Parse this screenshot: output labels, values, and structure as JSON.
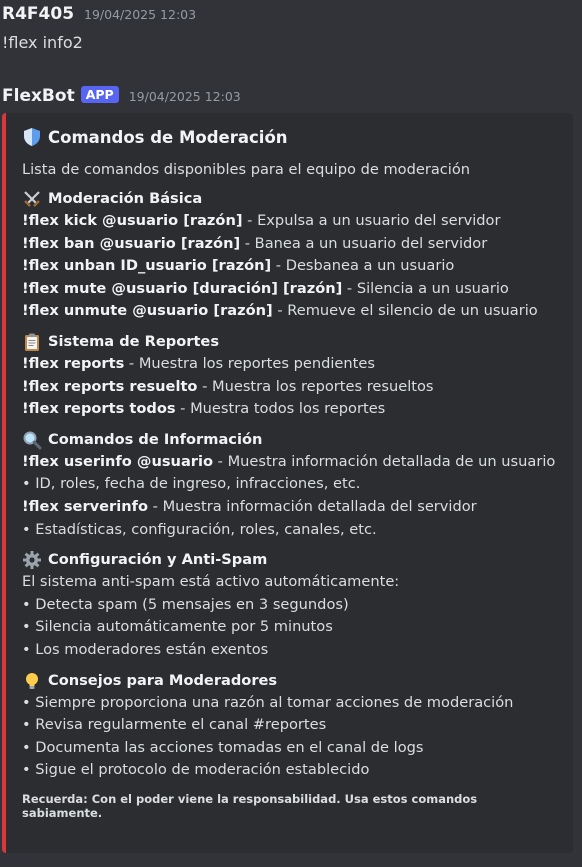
{
  "messages": [
    {
      "author": "R4F405",
      "timestamp": "19/04/2025 12:03",
      "content": "!flex info2"
    },
    {
      "author": "FlexBot",
      "badge": "APP",
      "timestamp": "19/04/2025 12:03"
    }
  ],
  "embed": {
    "accent_color": "#da373c",
    "title_icon": "shield-icon",
    "title": "Comandos de Moderación",
    "description": "Lista de comandos disponibles para el equipo de moderación",
    "fields": [
      {
        "icon": "crossed-swords-icon",
        "title": "Moderación Básica",
        "lines": [
          {
            "cmd": "!flex kick @usuario [razón]",
            "text": " - Expulsa a un usuario del servidor"
          },
          {
            "cmd": "!flex ban @usuario [razón]",
            "text": " - Banea a un usuario del servidor"
          },
          {
            "cmd": "!flex unban ID_usuario [razón]",
            "text": " - Desbanea a un usuario"
          },
          {
            "cmd": "!flex mute @usuario [duración] [razón]",
            "text": " - Silencia a un usuario"
          },
          {
            "cmd": "!flex unmute @usuario [razón]",
            "text": " - Remueve el silencio de un usuario"
          }
        ]
      },
      {
        "icon": "clipboard-icon",
        "title": "Sistema de Reportes",
        "lines": [
          {
            "cmd": "!flex reports",
            "text": " - Muestra los reportes pendientes"
          },
          {
            "cmd": "!flex reports resuelto",
            "text": " - Muestra los reportes resueltos"
          },
          {
            "cmd": "!flex reports todos",
            "text": " - Muestra todos los reportes"
          }
        ]
      },
      {
        "icon": "magnifier-icon",
        "title": "Comandos de Información",
        "lines": [
          {
            "cmd": "!flex userinfo @usuario",
            "text": " - Muestra información detallada de un usuario"
          },
          {
            "cmd": "",
            "text": "• ID, roles, fecha de ingreso, infracciones, etc."
          },
          {
            "cmd": "!flex serverinfo",
            "text": " - Muestra información detallada del servidor"
          },
          {
            "cmd": "",
            "text": "• Estadísticas, configuración, roles, canales, etc."
          }
        ]
      },
      {
        "icon": "gear-icon",
        "title": "Configuración y Anti-Spam",
        "lines": [
          {
            "cmd": "",
            "text": "El sistema anti-spam está activo automáticamente:"
          },
          {
            "cmd": "",
            "text": "• Detecta spam (5 mensajes en 3 segundos)"
          },
          {
            "cmd": "",
            "text": "• Silencia automáticamente por 5 minutos"
          },
          {
            "cmd": "",
            "text": "• Los moderadores están exentos"
          }
        ]
      },
      {
        "icon": "lightbulb-icon",
        "title": "Consejos para Moderadores",
        "lines": [
          {
            "cmd": "",
            "text": "• Siempre proporciona una razón al tomar acciones de moderación"
          },
          {
            "cmd": "",
            "text": "• Revisa regularmente el canal #reportes"
          },
          {
            "cmd": "",
            "text": "• Documenta las acciones tomadas en el canal de logs"
          },
          {
            "cmd": "",
            "text": "• Sigue el protocolo de moderación establecido"
          }
        ]
      }
    ],
    "footer": "Recuerda: Con el poder viene la responsabilidad. Usa estos comandos sabiamente."
  }
}
